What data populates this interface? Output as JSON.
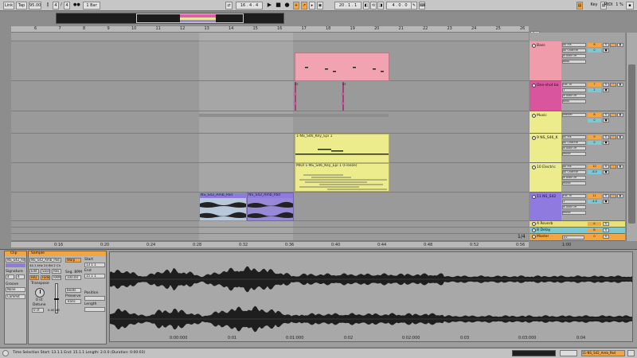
{
  "topbar": {
    "link": "Link",
    "tap": "Tap",
    "tempo": "95.00",
    "sig_num": "4",
    "sig_sep": "/",
    "sig_den": "4",
    "quant": "1 Bar",
    "position": "16 .   4 .   4",
    "loop_start": "20 .   1 .   1",
    "loop_len": "4 .   0 .   0",
    "key_label": "Key",
    "midi_label": "MIDI",
    "cpu": "1 %"
  },
  "ruler": {
    "bars": [
      "6",
      "7",
      "8",
      "9",
      "10",
      "11",
      "12",
      "13",
      "14",
      "15",
      "16",
      "17",
      "18",
      "19",
      "20",
      "21",
      "22",
      "23",
      "24",
      "25",
      "26"
    ],
    "set_label": "Set"
  },
  "timebar": {
    "times": [
      "0:16",
      "0:20",
      "0:24",
      "0:28",
      "0:32",
      "0:36",
      "0:40",
      "0:44",
      "0:48",
      "0:52",
      "0:56",
      "1:00"
    ],
    "page": "1/4"
  },
  "clips": {
    "key_epi": "1-NS_S46_Key_Epi 1",
    "key_epi_freeze": "MIDI 1-NS_S46_Key_Epi 1 (Freeze)",
    "amb_pad_a": "NS_S42_Amb_Pad",
    "amb_pad_b": "NS_S42_Amb_Pad",
    "oneshot_mark": "vs"
  },
  "tracks": [
    {
      "name": "Bass",
      "color": "#f09cab",
      "in": "All Ins",
      "ch": "All Channe",
      "mon": "In  Auto  Off",
      "out": "Bass",
      "num": "6",
      "vol": "0",
      "btn": "S"
    },
    {
      "name": "One-shot ba",
      "color": "#d9569f",
      "in": "Ext. In",
      "ch": "1",
      "mon": "In  Auto  Off",
      "out": "Bass",
      "num": "7",
      "vol": "2",
      "btn": "S"
    },
    {
      "name": "Music",
      "color": "#ecec8d",
      "in": "Master",
      "ch": "",
      "mon": "",
      "out": "",
      "num": "8",
      "vol": "0",
      "btn": "S"
    },
    {
      "name": "9 NS_S46_K",
      "color": "#ecec8d",
      "in": "All Ins",
      "ch": "All Channe",
      "mon": "In  Auto  Off",
      "out": "Music",
      "num": "9",
      "vol": "0",
      "btn": "S"
    },
    {
      "name": "10 Electric",
      "color": "#ecec8d",
      "in": "All Ins",
      "ch": "All Channe",
      "mon": "In  Auto  Off",
      "out": "Music",
      "num": "10",
      "vol": "-6.5",
      "btn": "S"
    },
    {
      "name": "11 NS_S42",
      "color": "#8f7ae0",
      "in": "Ext. In",
      "ch": "1",
      "mon": "In  Auto  Off",
      "out": "Music",
      "num": "11",
      "vol": "-4.0",
      "btn": "S"
    }
  ],
  "returns": [
    {
      "name": "A Reverb",
      "color": "#e8e07a",
      "num": "A"
    },
    {
      "name": "B Delay",
      "color": "#7cc9d4",
      "num": "B"
    },
    {
      "name": "Master",
      "color": "#f3a541",
      "num": "0",
      "sub": "1/2"
    }
  ],
  "clip_panel": {
    "title": "Clip",
    "name": "NS_S42_Amb_Pad",
    "signature": "Signature",
    "sig_a": "4",
    "sig_b": "4",
    "groove": "Groove",
    "groove_val": "None",
    "commit": "Commit"
  },
  "sample_panel": {
    "title": "Sample",
    "file": "NS_S42_Amb_Pad.wav",
    "info": "44.1 kHz 24 Bit 2 Ch",
    "edit": "Edit",
    "save": "Save",
    "rev": "Rev.",
    "warp": "Warp",
    "hiq": "HiQ",
    "fade": "Fade",
    "ram": "RAM",
    "start": "Start",
    "end": "End",
    "seg_bpm": "Seg. BPM",
    "bpm": "100.00",
    "transpose": "Transpose",
    "transpose_val": "0 st",
    "detune": "Detune",
    "detune_val": "0 ct",
    "gain": "0.00 dB",
    "mode": "Beats",
    "preserve": "Preserve",
    "trans": "Trans",
    "position": "Position",
    "length": "Length",
    "start_val": "13  1  1",
    "end_val": "15  1  1"
  },
  "wave_times": [
    "0:00:000",
    "0:01",
    "0:01:000",
    "0:02",
    "0:02:000",
    "0:03",
    "0:03:000",
    "0:04"
  ],
  "status": {
    "text": "Time Selection  Start: 13.1.1  End: 15.1.1  Length: 2.0.0  (Duration: 0:00:03)",
    "track": "11-NS_S42_Amb_Pad"
  }
}
